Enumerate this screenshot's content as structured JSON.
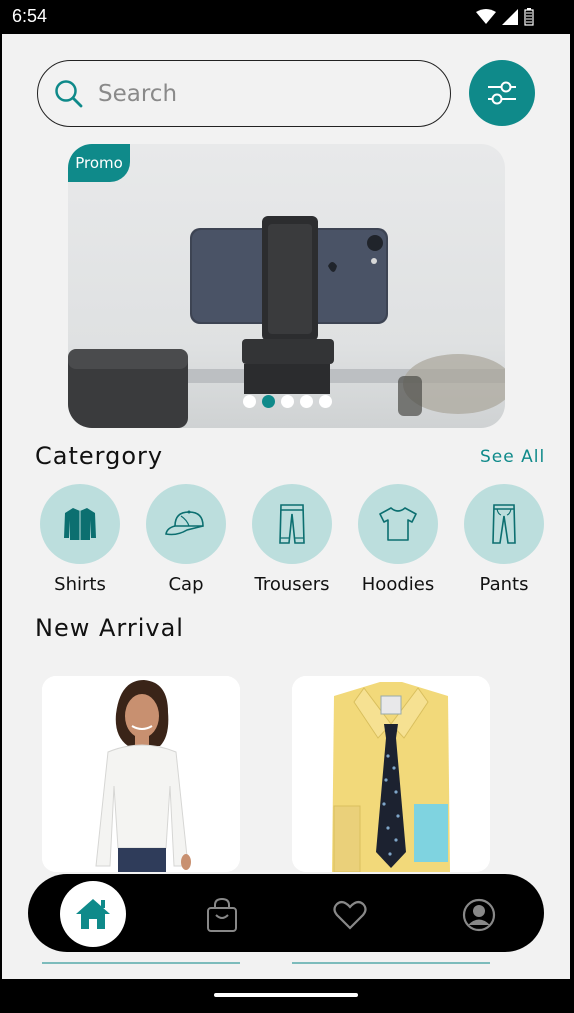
{
  "status": {
    "time": "6:54"
  },
  "search": {
    "placeholder": "Search"
  },
  "banner": {
    "badge": "Promo",
    "slide_count": 5,
    "active_slide": 2
  },
  "category_section": {
    "title": "Catergory",
    "see_all": "See  All",
    "items": [
      {
        "label": "Shirts",
        "icon": "shirt-icon"
      },
      {
        "label": "Cap",
        "icon": "cap-icon"
      },
      {
        "label": "Trousers",
        "icon": "trousers-icon"
      },
      {
        "label": "Hoodies",
        "icon": "tshirt-icon"
      },
      {
        "label": "Pants",
        "icon": "pants-icon"
      }
    ]
  },
  "new_arrival": {
    "title": "New  Arrival"
  },
  "nav": {
    "items": [
      "home-icon",
      "bag-icon",
      "heart-icon",
      "profile-icon"
    ],
    "active": "home-icon"
  },
  "colors": {
    "accent": "#0f8a8a",
    "category_bg": "#bcdedd",
    "background": "#f2f2f2"
  }
}
